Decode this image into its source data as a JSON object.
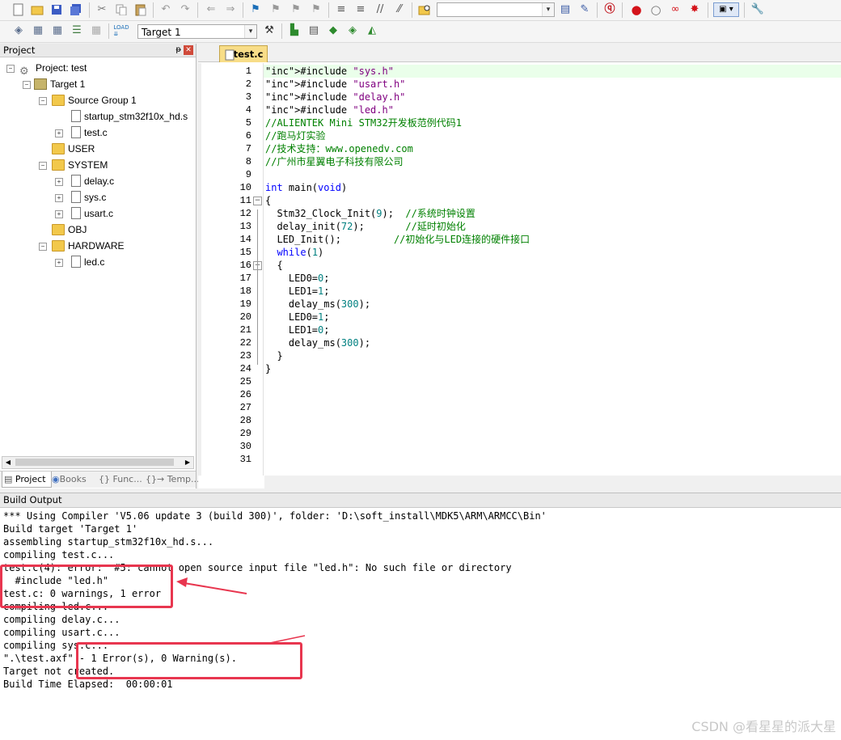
{
  "toolbar": {
    "target_name": "Target 1",
    "icons": [
      "new-file-icon",
      "open-icon",
      "save-icon",
      "save-all-icon",
      "cut-icon",
      "copy-icon",
      "paste-icon",
      "undo-icon",
      "redo-icon",
      "nav-back-icon",
      "nav-forward-icon",
      "bookmark-icon",
      "prev-bookmark-icon",
      "next-bookmark-icon",
      "clear-bookmarks-icon",
      "indent-icon",
      "unindent-icon",
      "comment-icon",
      "uncomment-icon",
      "find-in-files-icon"
    ],
    "build_icons": [
      "translate-icon",
      "build-icon",
      "rebuild-icon",
      "batch-build-icon",
      "stop-build-icon",
      "download-icon",
      "options-icon",
      "manage-components-icon",
      "pack-installer-icon",
      "select-packs-icon",
      "run-env-icon"
    ]
  },
  "project_panel": {
    "title": "Project",
    "tree": [
      {
        "label": "Project: test",
        "level": 0,
        "type": "project"
      },
      {
        "label": "Target 1",
        "level": 1,
        "type": "target"
      },
      {
        "label": "Source Group 1",
        "level": 2,
        "type": "folder"
      },
      {
        "label": "startup_stm32f10x_hd.s",
        "level": 3,
        "type": "file"
      },
      {
        "label": "test.c",
        "level": 3,
        "type": "file"
      },
      {
        "label": "USER",
        "level": 2,
        "type": "folder"
      },
      {
        "label": "SYSTEM",
        "level": 2,
        "type": "folder"
      },
      {
        "label": "delay.c",
        "level": 3,
        "type": "file"
      },
      {
        "label": "sys.c",
        "level": 3,
        "type": "file"
      },
      {
        "label": "usart.c",
        "level": 3,
        "type": "file"
      },
      {
        "label": "OBJ",
        "level": 2,
        "type": "folder"
      },
      {
        "label": "HARDWARE",
        "level": 2,
        "type": "folder"
      },
      {
        "label": "led.c",
        "level": 3,
        "type": "file"
      }
    ],
    "tabs": [
      "Project",
      "Books",
      "{} Func...",
      "{}→ Temp..."
    ]
  },
  "editor": {
    "tab": "test.c",
    "line_numbers": [
      "1",
      "2",
      "3",
      "4",
      "5",
      "6",
      "7",
      "8",
      "9",
      "10",
      "11",
      "12",
      "13",
      "14",
      "15",
      "16",
      "17",
      "18",
      "19",
      "20",
      "21",
      "22",
      "23",
      "24",
      "25",
      "26",
      "27",
      "28",
      "29",
      "30",
      "31"
    ],
    "lines": [
      "#include \"sys.h\"",
      "#include \"usart.h\"",
      "#include \"delay.h\"",
      "#include \"led.h\"",
      "//ALIENTEK Mini STM32开发板范例代码1",
      "//跑马灯实验",
      "//技术支持：www.openedv.com",
      "//广州市星翼电子科技有限公司",
      "",
      "int main(void)",
      "{",
      "  Stm32_Clock_Init(9);  //系统时钟设置",
      "  delay_init(72);       //延时初始化",
      "  LED_Init();         //初始化与LED连接的硬件接口",
      "  while(1)",
      "  {",
      "    LED0=0;",
      "    LED1=1;",
      "    delay_ms(300);",
      "    LED0=1;",
      "    LED1=0;",
      "    delay_ms(300);",
      "  }",
      "}",
      "",
      "",
      "",
      "",
      "",
      "",
      ""
    ]
  },
  "build_output": {
    "title": "Build Output",
    "lines": [
      "*** Using Compiler 'V5.06 update 3 (build 300)', folder: 'D:\\soft_install\\MDK5\\ARM\\ARMCC\\Bin'",
      "Build target 'Target 1'",
      "assembling startup_stm32f10x_hd.s...",
      "compiling test.c...",
      "test.c(4): error:  #5: cannot open source input file \"led.h\": No such file or directory",
      "  #include \"led.h\"",
      "test.c: 0 warnings, 1 error",
      "compiling led.c...",
      "compiling delay.c...",
      "compiling usart.c...",
      "compiling sys.c...",
      "\".\\test.axf\" - 1 Error(s), 0 Warning(s).",
      "Target not created.",
      "Build Time Elapsed:  00:00:01"
    ]
  },
  "watermark": "CSDN @看星星的派大星",
  "colors": {
    "keyword": "#0000ff",
    "string": "#800080",
    "comment": "#008000",
    "number": "#008080",
    "annotation": "#e8364f",
    "active_line": "#eaffea"
  }
}
